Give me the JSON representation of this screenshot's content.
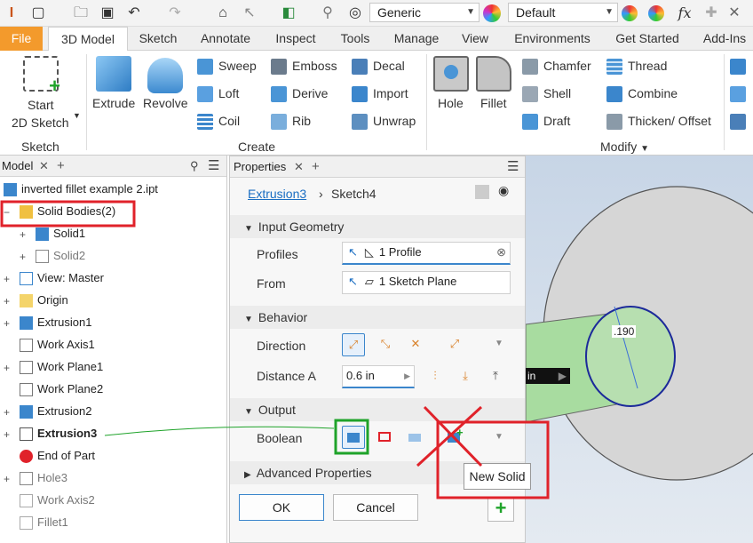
{
  "qat": {
    "material": "Generic",
    "appearance": "Default",
    "fx": "fx"
  },
  "tabs": [
    "File",
    "3D Model",
    "Sketch",
    "Annotate",
    "Inspect",
    "Tools",
    "Manage",
    "View",
    "Environments",
    "Get Started",
    "Add-Ins"
  ],
  "ribbon": {
    "start_sketch": [
      "Start",
      "2D Sketch"
    ],
    "sketch_group": "Sketch",
    "create": {
      "extrude": "Extrude",
      "revolve": "Revolve",
      "sweep": "Sweep",
      "loft": "Loft",
      "coil": "Coil",
      "emboss": "Emboss",
      "derive": "Derive",
      "rib": "Rib",
      "decal": "Decal",
      "import": "Import",
      "unwrap": "Unwrap",
      "group": "Create"
    },
    "modify": {
      "hole": "Hole",
      "fillet": "Fillet",
      "chamfer": "Chamfer",
      "shell": "Shell",
      "draft": "Draft",
      "thread": "Thread",
      "combine": "Combine",
      "thicken": "Thicken/ Offset",
      "group": "Modify"
    }
  },
  "model": {
    "title": "Model",
    "nodes": [
      "inverted fillet example 2.ipt",
      "Solid Bodies(2)",
      "Solid1",
      "Solid2",
      "View: Master",
      "Origin",
      "Extrusion1",
      "Work Axis1",
      "Work Plane1",
      "Work Plane2",
      "Extrusion2",
      "Extrusion3",
      "End of Part",
      "Hole3",
      "Work Axis2",
      "Fillet1"
    ]
  },
  "props": {
    "title": "Properties",
    "crumb_feature": "Extrusion3",
    "crumb_sketch": "Sketch4",
    "input_geometry": "Input Geometry",
    "profiles_label": "Profiles",
    "profiles_value": "1 Profile",
    "from_label": "From",
    "from_value": "1 Sketch Plane",
    "behavior": "Behavior",
    "direction_label": "Direction",
    "distance_label": "Distance A",
    "distance_value": "0.6 in",
    "output": "Output",
    "boolean_label": "Boolean",
    "advanced": "Advanced Properties",
    "ok": "OK",
    "cancel": "Cancel",
    "tooltip": "New Solid"
  },
  "view": {
    "dim": ".190",
    "unit": "in"
  },
  "colors": {
    "file_tab": "#f39a2c",
    "red_annot": "#e0222a",
    "green_annot": "#1fa32a",
    "shaft": "#a8dca0"
  }
}
